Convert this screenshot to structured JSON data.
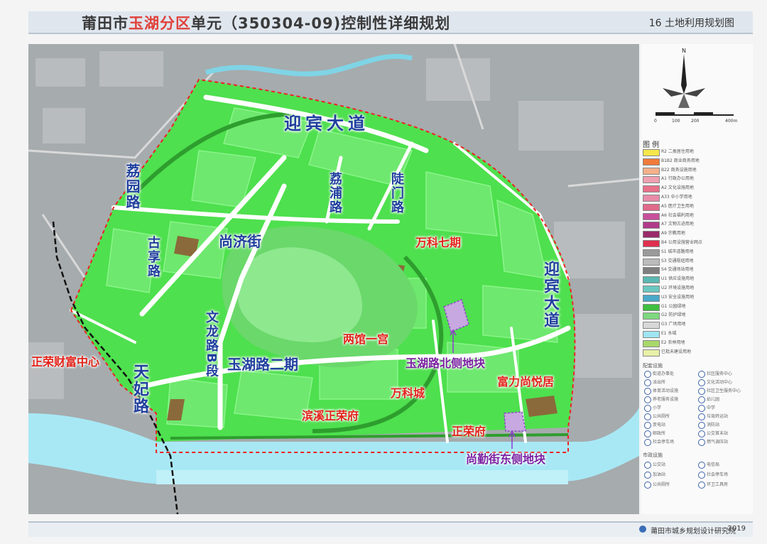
{
  "title": {
    "prefix": "莆田市",
    "highlight": "玉湖分区",
    "suffix": "单元（350304-09)控制性详细规划",
    "sheet": "16  土地利用规划图"
  },
  "roads": {
    "yingbin_top": "迎宾大道",
    "yingbin_right": "迎宾大道",
    "liyuan": "荔园路",
    "lipu": "荔浦路",
    "lumen": "陡门路",
    "shangji": "尚济街",
    "guxiang": "古享路",
    "wenlong": "文龙路B段",
    "yuhu2": "玉湖路二期",
    "tianfei": "天妃路"
  },
  "projects": {
    "wanke7": "万科七期",
    "liangguan": "两馆一宫",
    "wankecheng": "万科城",
    "binxi": "滨溪正荣府",
    "fuli": "富力尚悦居",
    "zhengrongfu": "正荣府",
    "zhengrong_wealth": "正荣财富中心"
  },
  "plots": {
    "north": "玉湖路北侧地块",
    "east": "尚勤街东侧地块"
  },
  "compass": {
    "n": "N",
    "scale": [
      "0",
      "100",
      "200",
      "400m"
    ]
  },
  "legend": {
    "title": "图  例",
    "items": [
      {
        "label": "R2 二类居住用地",
        "color": "#f5e64a"
      },
      {
        "label": "B1B2 商业商务用地",
        "color": "#f07a3a"
      },
      {
        "label": "B22 商务设施用地",
        "color": "#f5b08a"
      },
      {
        "label": "A1 行政办公用地",
        "color": "#f0a0b0"
      },
      {
        "label": "A2 文化设施用地",
        "color": "#e8708a"
      },
      {
        "label": "A33 中小学用地",
        "color": "#e88aa8"
      },
      {
        "label": "A5 医疗卫生用地",
        "color": "#e06a8a"
      },
      {
        "label": "A6 社会福利用地",
        "color": "#c8509a"
      },
      {
        "label": "A7 文物古迹用地",
        "color": "#b03a8a"
      },
      {
        "label": "A9 宗教用地",
        "color": "#9a2a6a"
      },
      {
        "label": "B4 公用设施营业网点",
        "color": "#e03050"
      },
      {
        "label": "S1 城市道路用地",
        "color": "#9a9a9a"
      },
      {
        "label": "S3 交通枢纽用地",
        "color": "#bbbbbb"
      },
      {
        "label": "S4 交通场站用地",
        "color": "#7f7f7f"
      },
      {
        "label": "U1 供应设施用地",
        "color": "#5ab8b0"
      },
      {
        "label": "U2 环境设施用地",
        "color": "#6ac8c0"
      },
      {
        "label": "U3 安全设施用地",
        "color": "#4aa8c8"
      },
      {
        "label": "G1 公园绿地",
        "color": "#3fbf3f"
      },
      {
        "label": "G2 防护绿地",
        "color": "#7ed87e"
      },
      {
        "label": "G3 广场用地",
        "color": "#d8d8d8"
      },
      {
        "label": "E1 水域",
        "color": "#9fe5f2"
      },
      {
        "label": "E2 农林用地",
        "color": "#a8d86a"
      },
      {
        "label": "已批未建设用地",
        "color": "#e8f0a8"
      }
    ]
  },
  "symbols_head": "配套设施",
  "symbols": [
    "街道办事处",
    "社区服务中心",
    "派出所",
    "文化活动中心",
    "体育活动设施",
    "社区卫生服务中心",
    "养老服务设施",
    "幼儿园",
    "小学",
    "中学",
    "公共厕所",
    "垃圾转运站",
    "变电站",
    "消防站",
    "邮政所",
    "公交首末站",
    "社会停车场",
    "燃气调压站"
  ],
  "symbols2_head": "市政设施",
  "symbols2": [
    "公交站",
    "电信局",
    "加油站",
    "社会停车场",
    "公共厕所",
    "环卫工具房"
  ],
  "footer": {
    "institute": "莆田市城乡规划设计研究院",
    "year": "2019"
  }
}
